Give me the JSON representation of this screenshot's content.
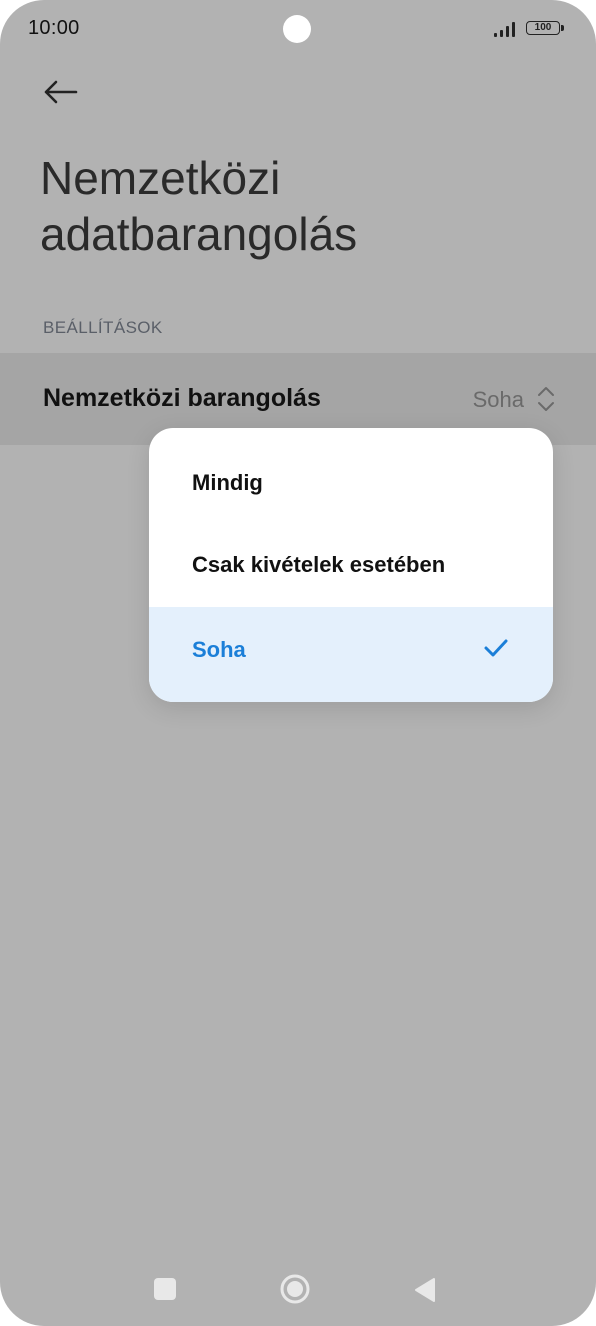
{
  "status_bar": {
    "time": "10:00",
    "battery": "100"
  },
  "header": {
    "back_icon": "arrow-left-icon",
    "title": "Nemzetközi adatbarangolás"
  },
  "settings": {
    "section_label": "BEÁLLÍTÁSOK",
    "row": {
      "label": "Nemzetközi barangolás",
      "value": "Soha",
      "icon": "chevron-up-down-icon"
    }
  },
  "dropdown": {
    "options": [
      {
        "label": "Mindig",
        "selected": false
      },
      {
        "label": "Csak kivételek esetében",
        "selected": false
      },
      {
        "label": "Soha",
        "selected": true
      }
    ],
    "selected_icon": "checkmark-icon"
  },
  "colors": {
    "accent": "#1b7fd8",
    "selected_bg": "#e4f0fc",
    "dim_overlay": "#b2b2b2"
  },
  "nav_bar": {
    "icons": [
      "recent-apps-icon",
      "home-icon",
      "back-triangle-icon"
    ]
  }
}
